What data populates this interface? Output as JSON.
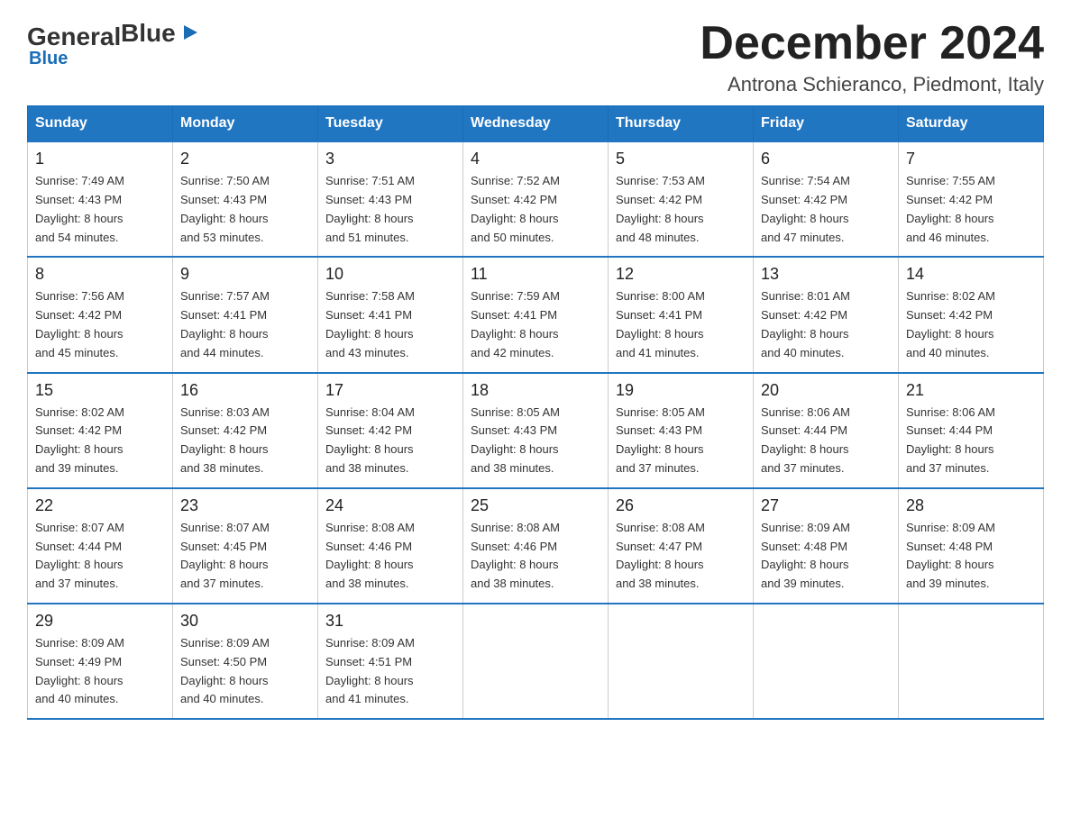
{
  "logo": {
    "general": "General",
    "blue": "Blue"
  },
  "header": {
    "title": "December 2024",
    "subtitle": "Antrona Schieranco, Piedmont, Italy"
  },
  "weekdays": [
    "Sunday",
    "Monday",
    "Tuesday",
    "Wednesday",
    "Thursday",
    "Friday",
    "Saturday"
  ],
  "weeks": [
    [
      {
        "day": "1",
        "sunrise": "7:49 AM",
        "sunset": "4:43 PM",
        "daylight": "8 hours and 54 minutes."
      },
      {
        "day": "2",
        "sunrise": "7:50 AM",
        "sunset": "4:43 PM",
        "daylight": "8 hours and 53 minutes."
      },
      {
        "day": "3",
        "sunrise": "7:51 AM",
        "sunset": "4:43 PM",
        "daylight": "8 hours and 51 minutes."
      },
      {
        "day": "4",
        "sunrise": "7:52 AM",
        "sunset": "4:42 PM",
        "daylight": "8 hours and 50 minutes."
      },
      {
        "day": "5",
        "sunrise": "7:53 AM",
        "sunset": "4:42 PM",
        "daylight": "8 hours and 48 minutes."
      },
      {
        "day": "6",
        "sunrise": "7:54 AM",
        "sunset": "4:42 PM",
        "daylight": "8 hours and 47 minutes."
      },
      {
        "day": "7",
        "sunrise": "7:55 AM",
        "sunset": "4:42 PM",
        "daylight": "8 hours and 46 minutes."
      }
    ],
    [
      {
        "day": "8",
        "sunrise": "7:56 AM",
        "sunset": "4:42 PM",
        "daylight": "8 hours and 45 minutes."
      },
      {
        "day": "9",
        "sunrise": "7:57 AM",
        "sunset": "4:41 PM",
        "daylight": "8 hours and 44 minutes."
      },
      {
        "day": "10",
        "sunrise": "7:58 AM",
        "sunset": "4:41 PM",
        "daylight": "8 hours and 43 minutes."
      },
      {
        "day": "11",
        "sunrise": "7:59 AM",
        "sunset": "4:41 PM",
        "daylight": "8 hours and 42 minutes."
      },
      {
        "day": "12",
        "sunrise": "8:00 AM",
        "sunset": "4:41 PM",
        "daylight": "8 hours and 41 minutes."
      },
      {
        "day": "13",
        "sunrise": "8:01 AM",
        "sunset": "4:42 PM",
        "daylight": "8 hours and 40 minutes."
      },
      {
        "day": "14",
        "sunrise": "8:02 AM",
        "sunset": "4:42 PM",
        "daylight": "8 hours and 40 minutes."
      }
    ],
    [
      {
        "day": "15",
        "sunrise": "8:02 AM",
        "sunset": "4:42 PM",
        "daylight": "8 hours and 39 minutes."
      },
      {
        "day": "16",
        "sunrise": "8:03 AM",
        "sunset": "4:42 PM",
        "daylight": "8 hours and 38 minutes."
      },
      {
        "day": "17",
        "sunrise": "8:04 AM",
        "sunset": "4:42 PM",
        "daylight": "8 hours and 38 minutes."
      },
      {
        "day": "18",
        "sunrise": "8:05 AM",
        "sunset": "4:43 PM",
        "daylight": "8 hours and 38 minutes."
      },
      {
        "day": "19",
        "sunrise": "8:05 AM",
        "sunset": "4:43 PM",
        "daylight": "8 hours and 37 minutes."
      },
      {
        "day": "20",
        "sunrise": "8:06 AM",
        "sunset": "4:44 PM",
        "daylight": "8 hours and 37 minutes."
      },
      {
        "day": "21",
        "sunrise": "8:06 AM",
        "sunset": "4:44 PM",
        "daylight": "8 hours and 37 minutes."
      }
    ],
    [
      {
        "day": "22",
        "sunrise": "8:07 AM",
        "sunset": "4:44 PM",
        "daylight": "8 hours and 37 minutes."
      },
      {
        "day": "23",
        "sunrise": "8:07 AM",
        "sunset": "4:45 PM",
        "daylight": "8 hours and 37 minutes."
      },
      {
        "day": "24",
        "sunrise": "8:08 AM",
        "sunset": "4:46 PM",
        "daylight": "8 hours and 38 minutes."
      },
      {
        "day": "25",
        "sunrise": "8:08 AM",
        "sunset": "4:46 PM",
        "daylight": "8 hours and 38 minutes."
      },
      {
        "day": "26",
        "sunrise": "8:08 AM",
        "sunset": "4:47 PM",
        "daylight": "8 hours and 38 minutes."
      },
      {
        "day": "27",
        "sunrise": "8:09 AM",
        "sunset": "4:48 PM",
        "daylight": "8 hours and 39 minutes."
      },
      {
        "day": "28",
        "sunrise": "8:09 AM",
        "sunset": "4:48 PM",
        "daylight": "8 hours and 39 minutes."
      }
    ],
    [
      {
        "day": "29",
        "sunrise": "8:09 AM",
        "sunset": "4:49 PM",
        "daylight": "8 hours and 40 minutes."
      },
      {
        "day": "30",
        "sunrise": "8:09 AM",
        "sunset": "4:50 PM",
        "daylight": "8 hours and 40 minutes."
      },
      {
        "day": "31",
        "sunrise": "8:09 AM",
        "sunset": "4:51 PM",
        "daylight": "8 hours and 41 minutes."
      },
      null,
      null,
      null,
      null
    ]
  ]
}
